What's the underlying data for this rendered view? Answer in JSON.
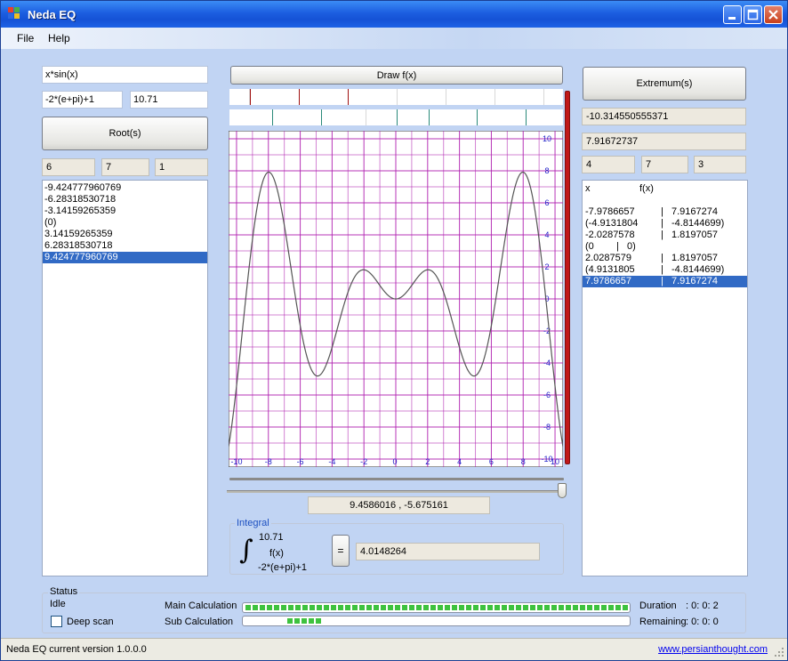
{
  "window": {
    "title": "Neda EQ",
    "minimize_icon": "minimize-icon",
    "maximize_icon": "maximize-icon",
    "close_icon": "close-icon"
  },
  "menu": [
    "File",
    "Help"
  ],
  "root_panel": {
    "function": "x*sin(x)",
    "range_from": "-2*(e+pi)+1",
    "range_to": "10.71",
    "root_button": "Root(s)",
    "params": [
      "6",
      "7",
      "1"
    ],
    "roots": [
      "-9.424777960769",
      "-6.28318530718",
      "-3.14159265359",
      "(0)",
      "3.14159265359",
      "6.28318530718",
      "9.424777960769"
    ],
    "selected_index": 6
  },
  "graph_panel": {
    "draw_button": "Draw f(x)",
    "cursor_readout": "9.4586016 , -5.675161",
    "slider_value": 1.0,
    "chart_data": {
      "type": "line",
      "function": "x*sin(x)",
      "xlim": [
        -10.5,
        10.5
      ],
      "ylim": [
        -10.5,
        10.5
      ],
      "x_ticks": [
        -10,
        -8,
        -6,
        -4,
        -2,
        0,
        2,
        4,
        6,
        8,
        10
      ],
      "y_ticks": [
        10,
        8,
        6,
        4,
        2,
        0,
        -2,
        -4,
        -6,
        -8,
        -10
      ],
      "grid": true,
      "colors": {
        "grid": "#b020b0",
        "axis_labels": "#2020c8",
        "curve": "#555555",
        "background": "#ffffff"
      }
    }
  },
  "integral": {
    "title": "Integral",
    "upper": "10.71",
    "integrand": "f(x)",
    "lower": "-2*(e+pi)+1",
    "equals_button": "=",
    "result": "4.0148264"
  },
  "extremum_panel": {
    "button": "Extremum(s)",
    "field1": "-10.314550555371",
    "field2": "7.91672737",
    "params": [
      "4",
      "7",
      "3"
    ],
    "header_x": "x",
    "header_fx": "f(x)",
    "rows": [
      {
        "x": "-7.9786657",
        "fx": "7.9167274",
        "sep": "|",
        "fx_offset": 100
      },
      {
        "x": "(-4.9131804",
        "fx": "-4.8144699)",
        "sep": "|",
        "fx_offset": 100
      },
      {
        "x": "-2.0287578",
        "fx": "1.8197057",
        "sep": "|",
        "fx_offset": 100
      },
      {
        "x": "(0",
        "fx": "0)",
        "sep": "|",
        "fx_offset": 50
      },
      {
        "x": "2.0287579",
        "fx": "1.8197057",
        "sep": "|",
        "fx_offset": 100
      },
      {
        "x": "(4.9131805",
        "fx": "-4.8144699)",
        "sep": "|",
        "fx_offset": 100
      },
      {
        "x": "7.9786657",
        "fx": "7.9167274",
        "sep": "|",
        "fx_offset": 100
      }
    ],
    "selected_index": 6
  },
  "status": {
    "title": "Status",
    "state": "Idle",
    "deep_scan_label": "Deep scan",
    "deep_scan_checked": false,
    "main_calc_label": "Main Calculation",
    "main_calc_progress": 1.0,
    "sub_calc_label": "Sub  Calculation",
    "sub_calc_progress": 0.09,
    "duration_label": "Duration",
    "duration_value": ":   0: 0: 2",
    "remaining_label": "Remaining",
    "remaining_value": ":   0: 0: 0"
  },
  "statusbar": {
    "version": "Neda EQ current version 1.0.0.0",
    "link": "www.persianthought.com"
  }
}
